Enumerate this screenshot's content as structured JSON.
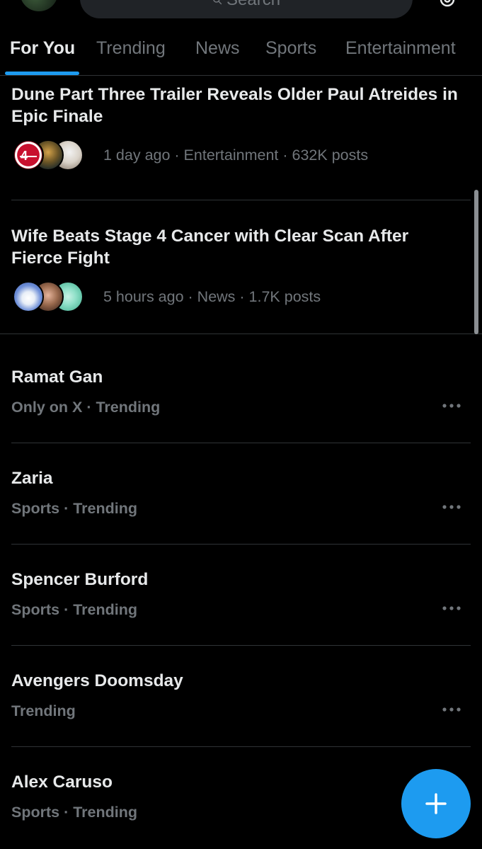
{
  "header": {
    "search_placeholder": "Search",
    "avatar_icon": "profile-avatar",
    "settings_icon": "gear-icon"
  },
  "tabs": [
    {
      "label": "For You",
      "active": true
    },
    {
      "label": "Trending",
      "active": false
    },
    {
      "label": "News",
      "active": false
    },
    {
      "label": "Sports",
      "active": false
    },
    {
      "label": "Entertainment",
      "active": false
    }
  ],
  "stories": [
    {
      "title": "Dune Part Three Trailer Reveals Older Paul Atreides in Epic Finale",
      "meta": "1 day ago · Entertainment · 632K posts"
    },
    {
      "title": "Wife Beats Stage 4 Cancer with Clear Scan After Fierce Fight",
      "meta": "5 hours ago · News · 1.7K posts"
    }
  ],
  "trends": [
    {
      "name": "Ramat Gan",
      "meta": "Only on X · Trending"
    },
    {
      "name": "Zaria",
      "meta": "Sports · Trending"
    },
    {
      "name": "Spencer Burford",
      "meta": "Sports · Trending"
    },
    {
      "name": "Avengers Doomsday",
      "meta": "Trending"
    },
    {
      "name": "Alex Caruso",
      "meta": "Sports · Trending"
    }
  ],
  "compose_button": {
    "icon": "plus-icon"
  },
  "colors": {
    "background": "#000000",
    "text_primary": "#e7e9ea",
    "text_secondary": "#71767b",
    "accent": "#1d9bf0",
    "divider": "#2f3336"
  }
}
